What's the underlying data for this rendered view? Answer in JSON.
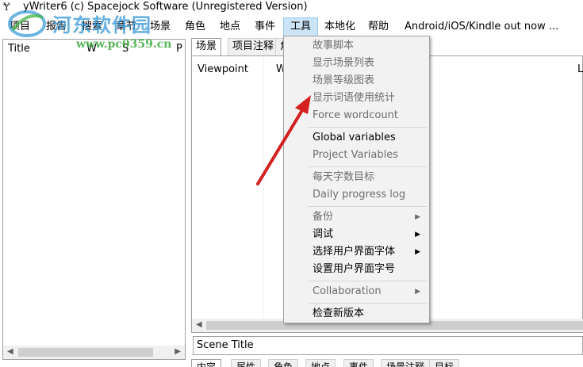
{
  "window": {
    "title": "yWriter6 (c) Spacejock Software (Unregistered Version)",
    "app_icon": "ywriter-logo-icon"
  },
  "menubar": {
    "items": [
      "项目",
      "报告",
      "搜索",
      "章节",
      "场景",
      "角色",
      "地点",
      "事件",
      "工具",
      "本地化",
      "帮助",
      "Android/iOS/Kindle out now ..."
    ],
    "active": "工具"
  },
  "chapter_list": {
    "columns": [
      "Title",
      "W",
      "S",
      "P"
    ]
  },
  "tabs": {
    "items": [
      "场景",
      "项目注释",
      "角"
    ],
    "selected": "场景"
  },
  "scene_list": {
    "columns": [
      "Viewpoint",
      "W",
      "L"
    ]
  },
  "scene_title": {
    "value": "Scene Title"
  },
  "bottom_tabs": {
    "items": [
      "内容",
      "属性",
      "角色",
      "地点",
      "事件",
      "场景注释",
      "目标"
    ],
    "selected": "内容"
  },
  "tools_menu": {
    "story_script": "故事脚本",
    "show_scene_list": "显示场景列表",
    "scene_rating_chart": "场景等级图表",
    "word_usage_stats": "显示词语使用统计",
    "force_wordcount": "Force wordcount",
    "global_variables": "Global variables",
    "project_variables": "Project Variables",
    "daily_word_target": "每天字数目标",
    "daily_progress_log": "Daily progress log",
    "backup": "备份",
    "debug": "调试",
    "choose_ui_font": "选择用户界面字体",
    "set_ui_font_size": "设置用户界面字号",
    "collaboration": "Collaboration",
    "check_new_version": "检查新版本"
  },
  "watermark": {
    "name": "河东软件园",
    "url": "www.pc0359.cn"
  },
  "colors": {
    "menu_highlight": "#cce4f7",
    "disabled_text": "#6d6d6d",
    "annotation_arrow": "#d42020"
  }
}
